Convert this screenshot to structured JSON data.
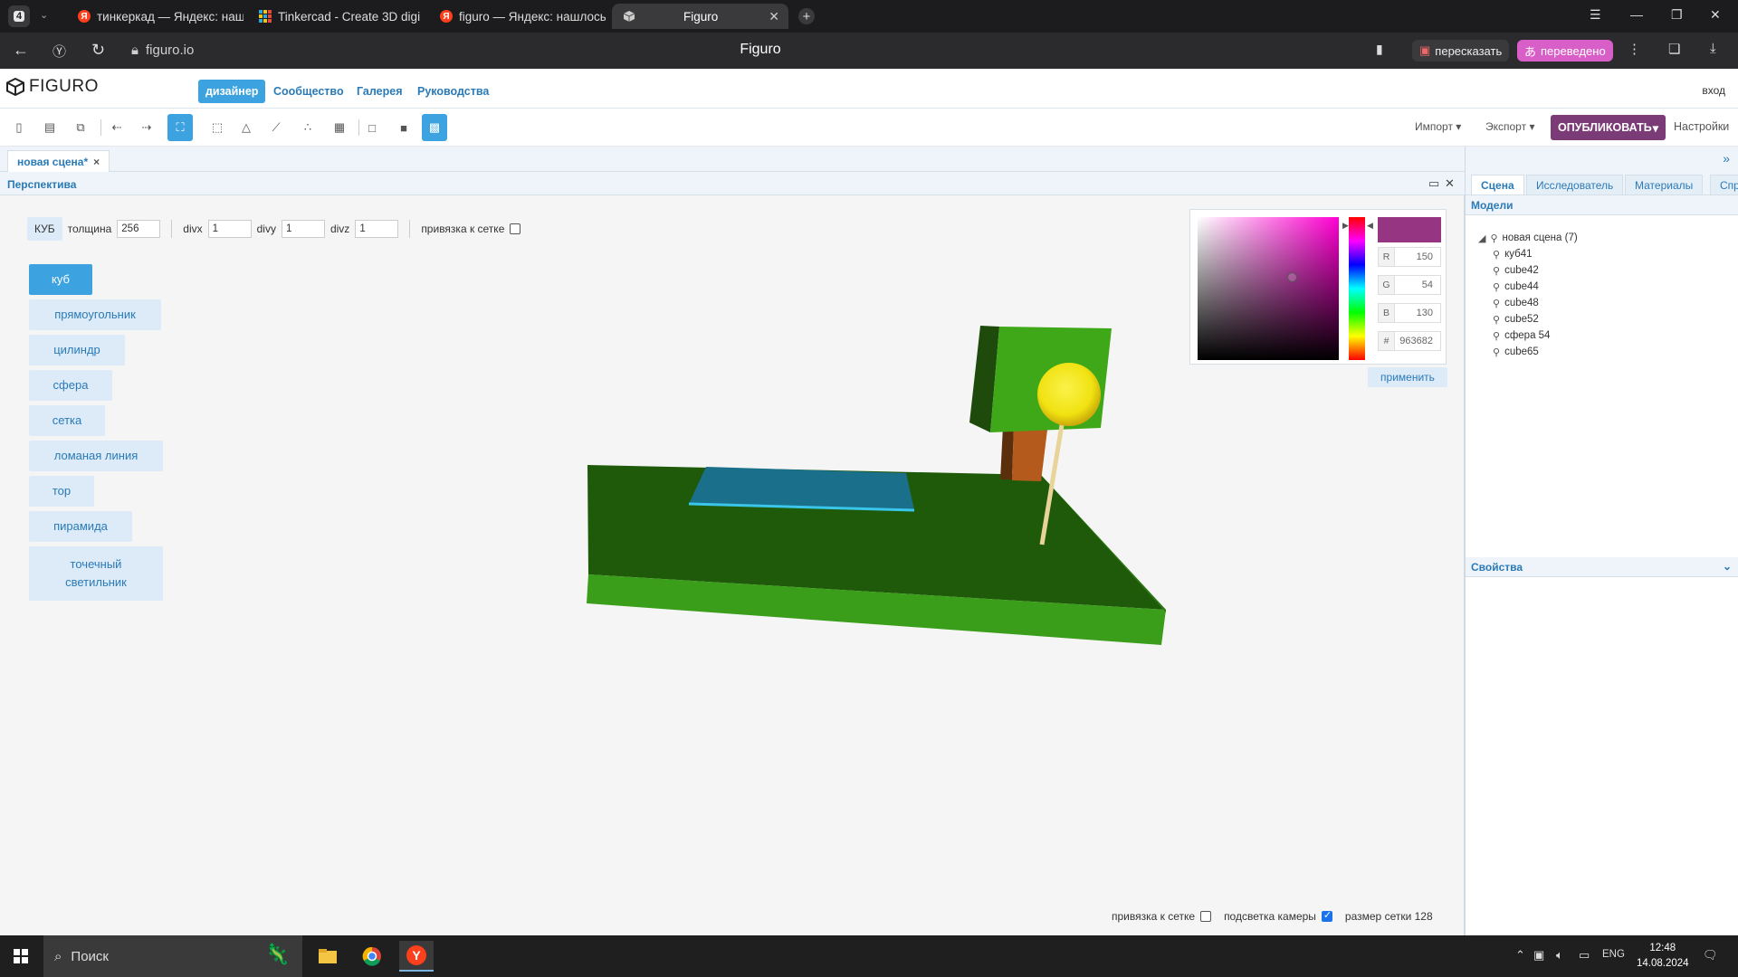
{
  "browser": {
    "tab_count": "4",
    "tabs": [
      {
        "title": "тинкеркад — Яндекс: наш",
        "icon": "yandex-icon"
      },
      {
        "title": "Tinkercad - Create 3D digi",
        "icon": "tinkercad-icon"
      },
      {
        "title": "figuro — Яндекс: нашлось",
        "icon": "yandex-icon"
      },
      {
        "title": "Figuro",
        "icon": "figuro-cube-icon"
      }
    ],
    "url": "figuro.io",
    "page_title": "Figuro",
    "retell_label": "пересказать",
    "translated_label": "переведено"
  },
  "app": {
    "logo_text": "FIGURO",
    "nav": [
      "дизайнер",
      "Сообщество",
      "Галерея",
      "Руководства"
    ],
    "login": "вход",
    "toolbar": {
      "import_label": "Импорт",
      "export_label": "Экспорт",
      "publish_label": "ОПУБЛИКОВАТЬ",
      "settings_label": "Настройки"
    },
    "doc_tab": "новая сцена*",
    "viewport": {
      "title": "Перспектива",
      "shape_label": "КУБ",
      "thickness_label": "толщина",
      "thickness_value": "256",
      "divx_label": "divx",
      "divx_value": "1",
      "divy_label": "divy",
      "divy_value": "1",
      "divz_label": "divz",
      "divz_value": "1",
      "snap_label": "привязка к сетке",
      "shapes": [
        "куб",
        "прямоугольник",
        "цилиндр",
        "сфера",
        "сетка",
        "ломаная линия",
        "тор",
        "пирамида",
        "точечный светильник"
      ],
      "footer": {
        "snap_label": "привязка к сетке",
        "camera_light_label": "подсветка камеры",
        "grid_size_label": "размер сетки 128"
      }
    },
    "color_picker": {
      "r": "150",
      "g": "54",
      "b": "130",
      "hex": "963682",
      "r_label": "R",
      "g_label": "G",
      "b_label": "B",
      "hex_label": "#",
      "apply_label": "применить",
      "current_color": "#963682"
    },
    "right_panel": {
      "tabs": [
        "Сцена",
        "Исследователь",
        "Материалы",
        "Спр"
      ],
      "models_header": "Модели",
      "root": "новая сцена (7)",
      "children": [
        "куб41",
        "cube42",
        "cube44",
        "cube48",
        "cube52",
        "сфера 54",
        "cube65"
      ],
      "properties_header": "Свойства"
    }
  },
  "taskbar": {
    "search_placeholder": "Поиск",
    "lang": "ENG",
    "time": "12:48",
    "date": "14.08.2024"
  },
  "colors": {
    "accent": "#3ca3e0",
    "publish": "#7a3b76",
    "ground_top": "#1f5a0a",
    "ground_front": "#3a9e1a",
    "water": "#1a6f8a",
    "tree_crown": "#3fa818",
    "sun": "#f3e818"
  }
}
